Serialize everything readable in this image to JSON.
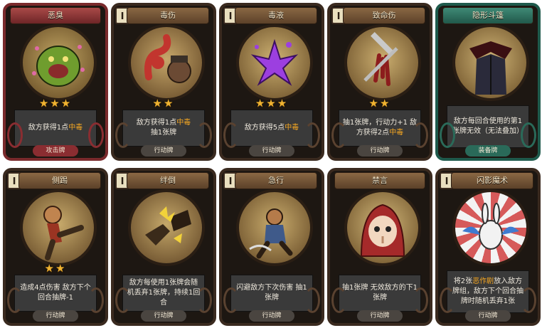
{
  "cards": [
    {
      "title": "恶臭",
      "cost": "",
      "stars": 3,
      "desc_pre": "敌方获得1点",
      "desc_hl": "中毒",
      "desc_post": "",
      "type": "攻击牌",
      "frame": "red",
      "art": "ogre"
    },
    {
      "title": "毒伤",
      "cost": "I",
      "stars": 2,
      "desc_pre": "敌方获得1点",
      "desc_hl": "中毒",
      "desc_post": "抽1张牌",
      "type": "行动牌",
      "frame": "brown",
      "art": "tentacle"
    },
    {
      "title": "毒液",
      "cost": "I",
      "stars": 3,
      "desc_pre": "敌方获得5点",
      "desc_hl": "中毒",
      "desc_post": "",
      "type": "行动牌",
      "frame": "brown",
      "art": "poison"
    },
    {
      "title": "致命伤",
      "cost": "I",
      "stars": 2,
      "desc_pre": "抽1张牌，行动力+1 敌方获得2点",
      "desc_hl": "中毒",
      "desc_post": "",
      "type": "行动牌",
      "frame": "brown",
      "art": "dagger"
    },
    {
      "title": "隐形斗篷",
      "cost": "",
      "stars": 0,
      "desc_pre": "敌方每回合使用的第1张牌无效（无法叠加）",
      "desc_hl": "",
      "desc_post": "",
      "type": "装备牌",
      "frame": "teal",
      "art": "cloak"
    },
    {
      "title": "侧踢",
      "cost": "I",
      "stars": 2,
      "desc_pre": "造成4点伤害 敌方下个回合抽牌-1",
      "desc_hl": "",
      "desc_post": "",
      "type": "行动牌",
      "frame": "brown",
      "art": "kick"
    },
    {
      "title": "绊倒",
      "cost": "I",
      "stars": 0,
      "desc_pre": "敌方每使用1张牌会随机丢弃1张牌，持续1回合",
      "desc_hl": "",
      "desc_post": "",
      "type": "行动牌",
      "frame": "brown",
      "art": "trip"
    },
    {
      "title": "急行",
      "cost": "I",
      "stars": 0,
      "desc_pre": "闪避敌方下次伤害 抽1张牌",
      "desc_hl": "",
      "desc_post": "",
      "type": "行动牌",
      "frame": "brown",
      "art": "dash"
    },
    {
      "title": "禁言",
      "cost": "",
      "stars": 0,
      "desc_pre": "抽1张牌 无效敌方的下1张牌",
      "desc_hl": "",
      "desc_post": "",
      "type": "行动牌",
      "frame": "brown",
      "art": "hood"
    },
    {
      "title": "闪影魔术",
      "cost": "I",
      "stars": 0,
      "desc_pre": "将2张",
      "desc_hl": "恶作剧",
      "desc_post": "放入敌方牌组，敌方下个回合抽牌时随机丢弃1张",
      "type": "行动牌",
      "frame": "brown",
      "art": "rabbit"
    }
  ]
}
